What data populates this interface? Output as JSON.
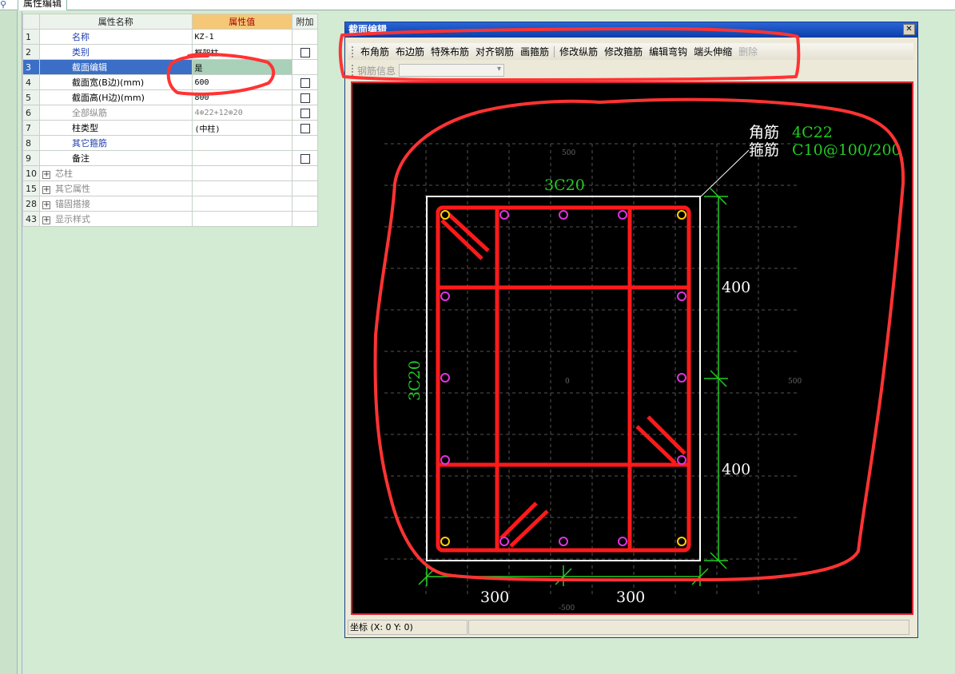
{
  "top": {
    "tab_label": "属性编辑"
  },
  "grid": {
    "headers": {
      "name": "属性名称",
      "value": "属性值",
      "extra": "附加"
    },
    "rows": [
      {
        "num": "1",
        "name": "名称",
        "value": "KZ-1"
      },
      {
        "num": "2",
        "name": "类别",
        "value": "框架柱"
      },
      {
        "num": "3",
        "name": "截面编辑",
        "value": "是"
      },
      {
        "num": "4",
        "name": "截面宽(B边)(mm)",
        "value": "600"
      },
      {
        "num": "5",
        "name": "截面高(H边)(mm)",
        "value": "800"
      },
      {
        "num": "6",
        "name": "全部纵筋",
        "value": "4⊕22+12⊕20"
      },
      {
        "num": "7",
        "name": "柱类型",
        "value": "(中柱)"
      },
      {
        "num": "8",
        "name": "其它箍筋",
        "value": ""
      },
      {
        "num": "9",
        "name": "备注",
        "value": ""
      },
      {
        "num": "10",
        "name": "芯柱",
        "value": ""
      },
      {
        "num": "15",
        "name": "其它属性",
        "value": ""
      },
      {
        "num": "28",
        "name": "锚固搭接",
        "value": ""
      },
      {
        "num": "43",
        "name": "显示样式",
        "value": ""
      }
    ]
  },
  "editor": {
    "title": "截面编辑",
    "toolbar": [
      "布角筋",
      "布边筋",
      "特殊布筋",
      "对齐钢筋",
      "画箍筋",
      "修改纵筋",
      "修改箍筋",
      "编辑弯钩",
      "端头伸缩",
      "删除"
    ],
    "rebar_info_label": "钢筋信息",
    "status_coord": "坐标 (X: 0 Y: 0)"
  },
  "drawing": {
    "corner_label": "角筋",
    "corner_value": "4C22",
    "stirrup_label": "箍筋",
    "stirrup_value": "C10@100/200",
    "top_rebar": "3C20",
    "side_rebar": "3C20",
    "dim_v1": "400",
    "dim_v2": "400",
    "dim_h1": "300",
    "dim_h2": "300",
    "axis_top": "500",
    "axis_right": "500",
    "axis_bottom": "-500",
    "axis_zero": "0"
  },
  "colors": {
    "highlight_red": "#ff3333",
    "rebar_red": "#ff1a1a",
    "dim_green": "#22cc22",
    "selection_blue": "#3b6fc7"
  }
}
